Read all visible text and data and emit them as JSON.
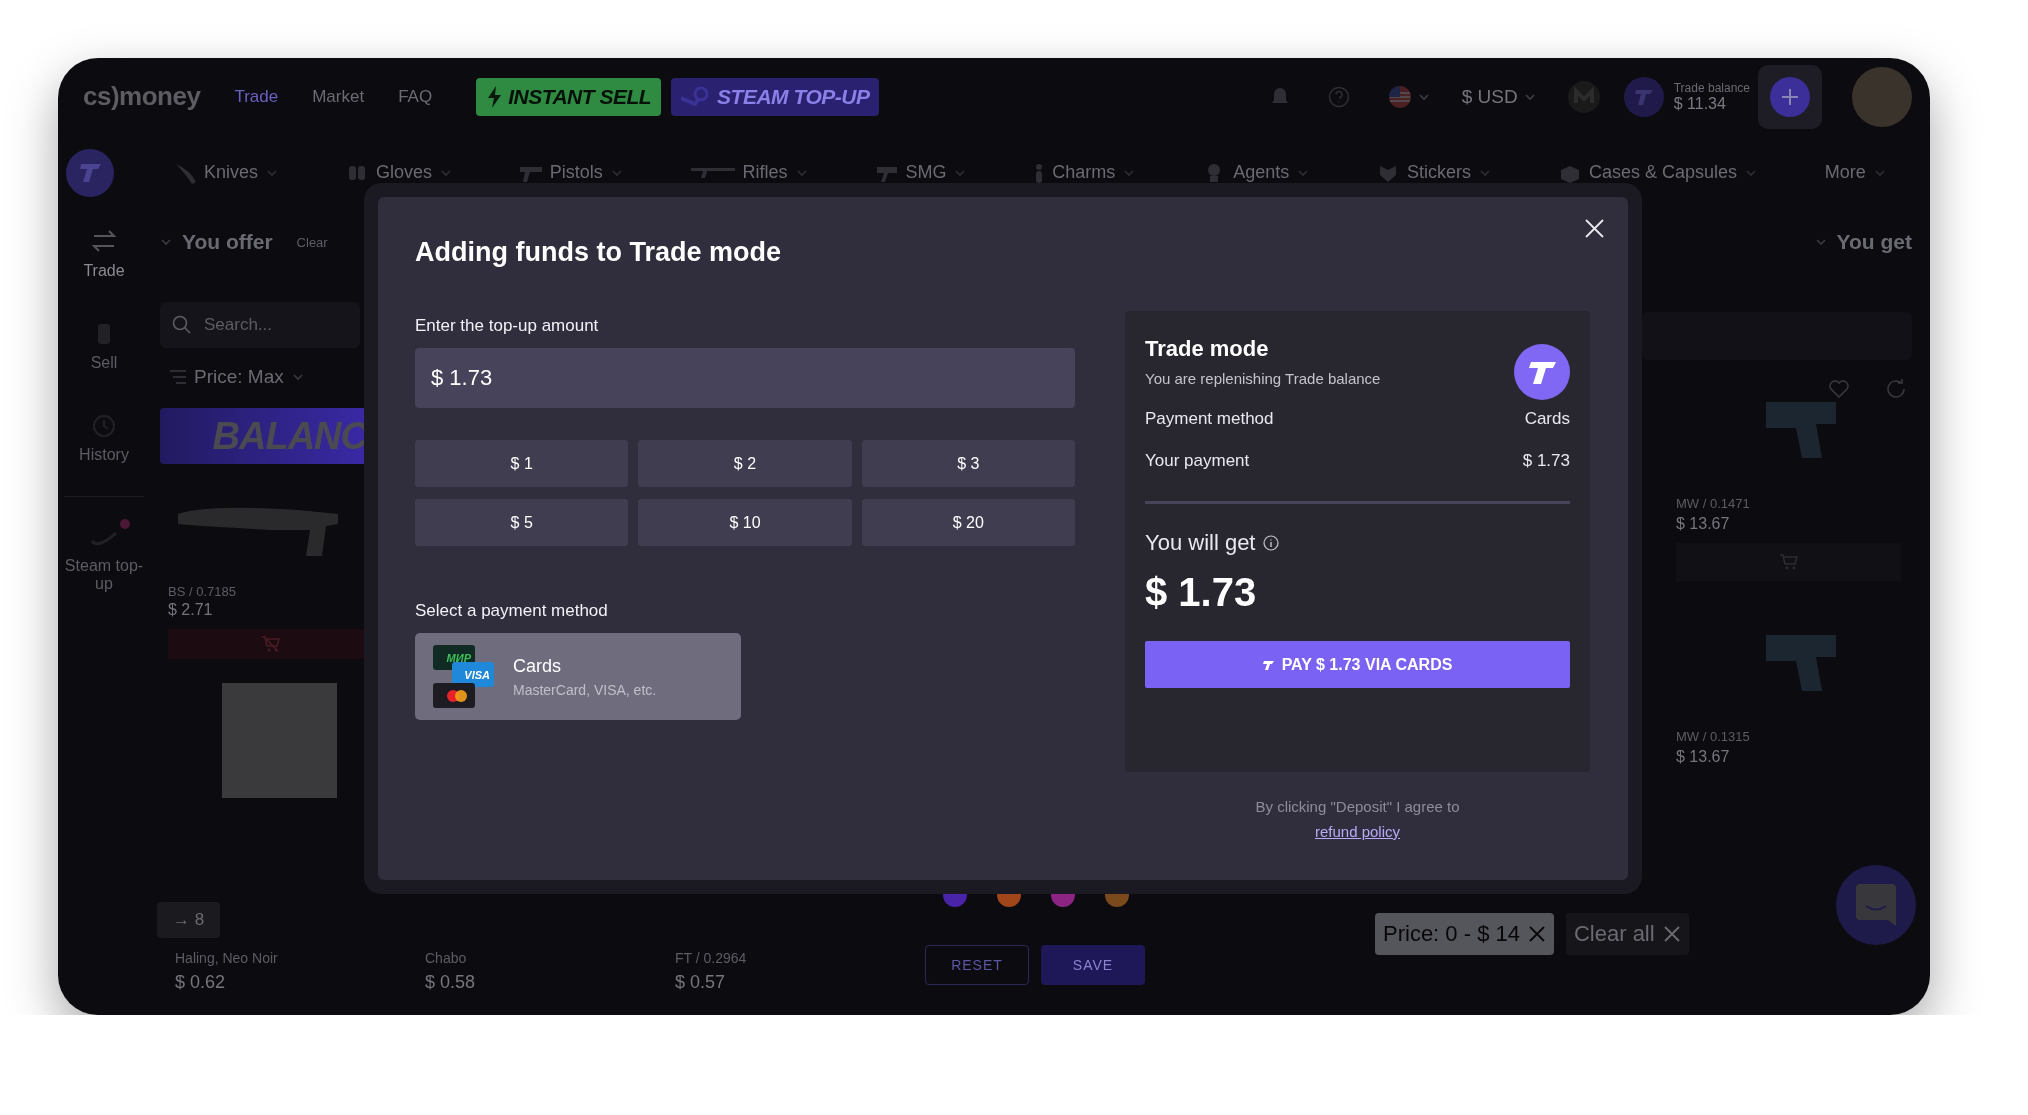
{
  "header": {
    "logo": "cs)money",
    "nav": [
      {
        "label": "Trade",
        "selected": true
      },
      {
        "label": "Market",
        "selected": false
      },
      {
        "label": "FAQ",
        "selected": false
      }
    ],
    "promos": [
      {
        "label": "INSTANT SELL",
        "kind": "sell"
      },
      {
        "label": "STEAM TOP-UP",
        "kind": "steam"
      }
    ],
    "currency": "$ USD",
    "balance": {
      "label": "Trade balance",
      "value": "$ 11.34"
    }
  },
  "categories": [
    "Knives",
    "Gloves",
    "Pistols",
    "Rifles",
    "SMG",
    "Charms",
    "Agents",
    "Stickers",
    "Cases & Capsules",
    "More"
  ],
  "sidebar": [
    {
      "label": "Trade",
      "selected": true,
      "notification": false
    },
    {
      "label": "Sell",
      "selected": false,
      "notification": false
    },
    {
      "label": "History",
      "selected": false,
      "notification": false
    },
    {
      "label": "Steam top-up",
      "selected": false,
      "notification": true
    }
  ],
  "offer": {
    "title": "You offer",
    "clear": "Clear",
    "search": {
      "placeholder": "Search..."
    },
    "sort": "Price: Max",
    "banner": "BALANC",
    "items": [
      {
        "wear": "BS / 0.7185",
        "price": "$ 2.71"
      }
    ]
  },
  "count_badge": "→ 8",
  "bottom_items": [
    {
      "name": "Haling, Neo Noir",
      "price": "$ 0.62"
    },
    {
      "name": "Chabo",
      "price": "$ 0.58"
    },
    {
      "name": "FT / 0.2964",
      "price": "$ 0.57"
    }
  ],
  "filter": {
    "colors": [
      {
        "color": "#4a24a8"
      },
      {
        "color": "#a0461a"
      },
      {
        "color": "#8c2484"
      },
      {
        "color": "#7a4a1c"
      }
    ],
    "buttons": [
      "RESET",
      "SAVE"
    ]
  },
  "get": {
    "title": "You get",
    "items": [
      {
        "wear": "MW / 0.1471",
        "price": "$ 13.67"
      },
      {
        "wear": "MW / 0.1315",
        "price": "$ 13.67"
      }
    ]
  },
  "chips": [
    {
      "label": "Price: 0 - $ 14",
      "kind": "filter"
    },
    {
      "label": "Clear all",
      "kind": "clear"
    }
  ],
  "modal": {
    "title": "Adding funds to Trade mode",
    "amount_label": "Enter the top-up amount",
    "amount": {
      "value": "$ 1.73"
    },
    "presets": [
      "$ 1",
      "$ 2",
      "$ 3",
      "$ 5",
      "$ 10",
      "$ 20"
    ],
    "method_label": "Select a payment method",
    "methods": [
      {
        "name": "Cards",
        "description": "MasterCard, VISA, etc.",
        "brands": [
          "МИР",
          "VISA"
        ],
        "selected": true
      }
    ],
    "summary": {
      "title": "Trade mode",
      "subtitle": "You are replenishing Trade balance",
      "rows": [
        {
          "label": "Payment method",
          "value": "Cards"
        },
        {
          "label": "Your payment",
          "value": "$ 1.73"
        }
      ],
      "receive_label": "You will get",
      "receive_value": "$ 1.73",
      "pay_button": "PAY $ 1.73 VIA CARDS"
    },
    "agreement": "By clicking \"Deposit\" I agree to",
    "refund_link": "refund policy"
  }
}
